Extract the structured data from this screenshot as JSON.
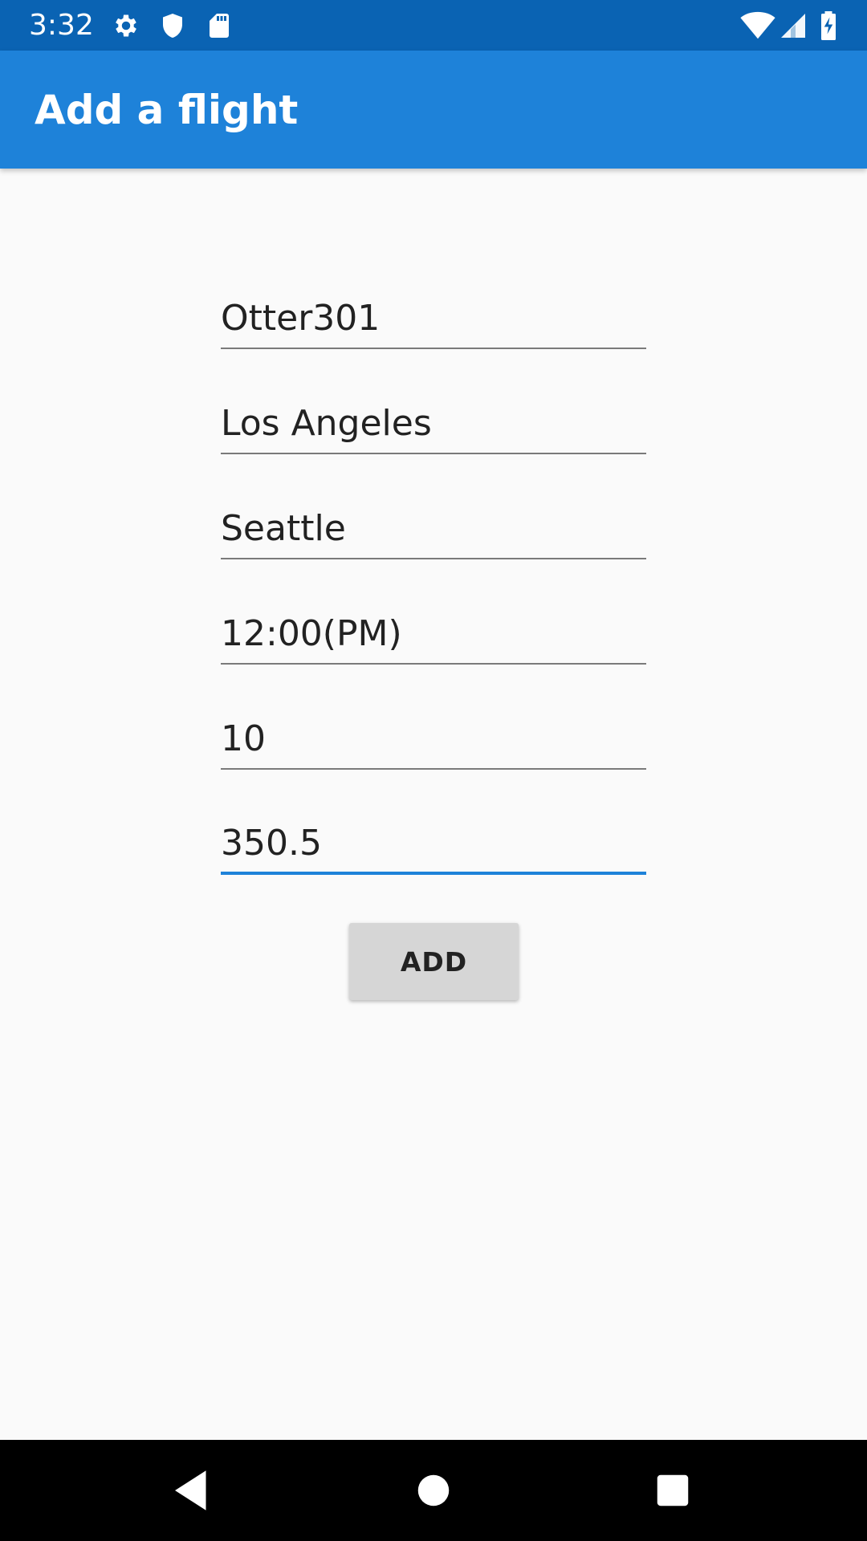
{
  "status_bar": {
    "time": "3:32",
    "icons": [
      "gear-icon",
      "shield-icon",
      "sd-card-icon",
      "wifi-icon",
      "signal-icon",
      "battery-charging-icon"
    ],
    "background": "#0a63b3"
  },
  "app_bar": {
    "title": "Add a flight",
    "background": "#1e82d9"
  },
  "form": {
    "fields": [
      {
        "value": "Otter301"
      },
      {
        "value": "Los Angeles"
      },
      {
        "value": "Seattle"
      },
      {
        "value": "12:00(PM)"
      },
      {
        "value": "10"
      },
      {
        "value": "350.5",
        "focused": true
      }
    ],
    "add_label": "ADD",
    "accent": "#1e82d9"
  },
  "nav_bar": {
    "buttons": [
      "back-icon",
      "home-icon",
      "recents-icon"
    ]
  }
}
